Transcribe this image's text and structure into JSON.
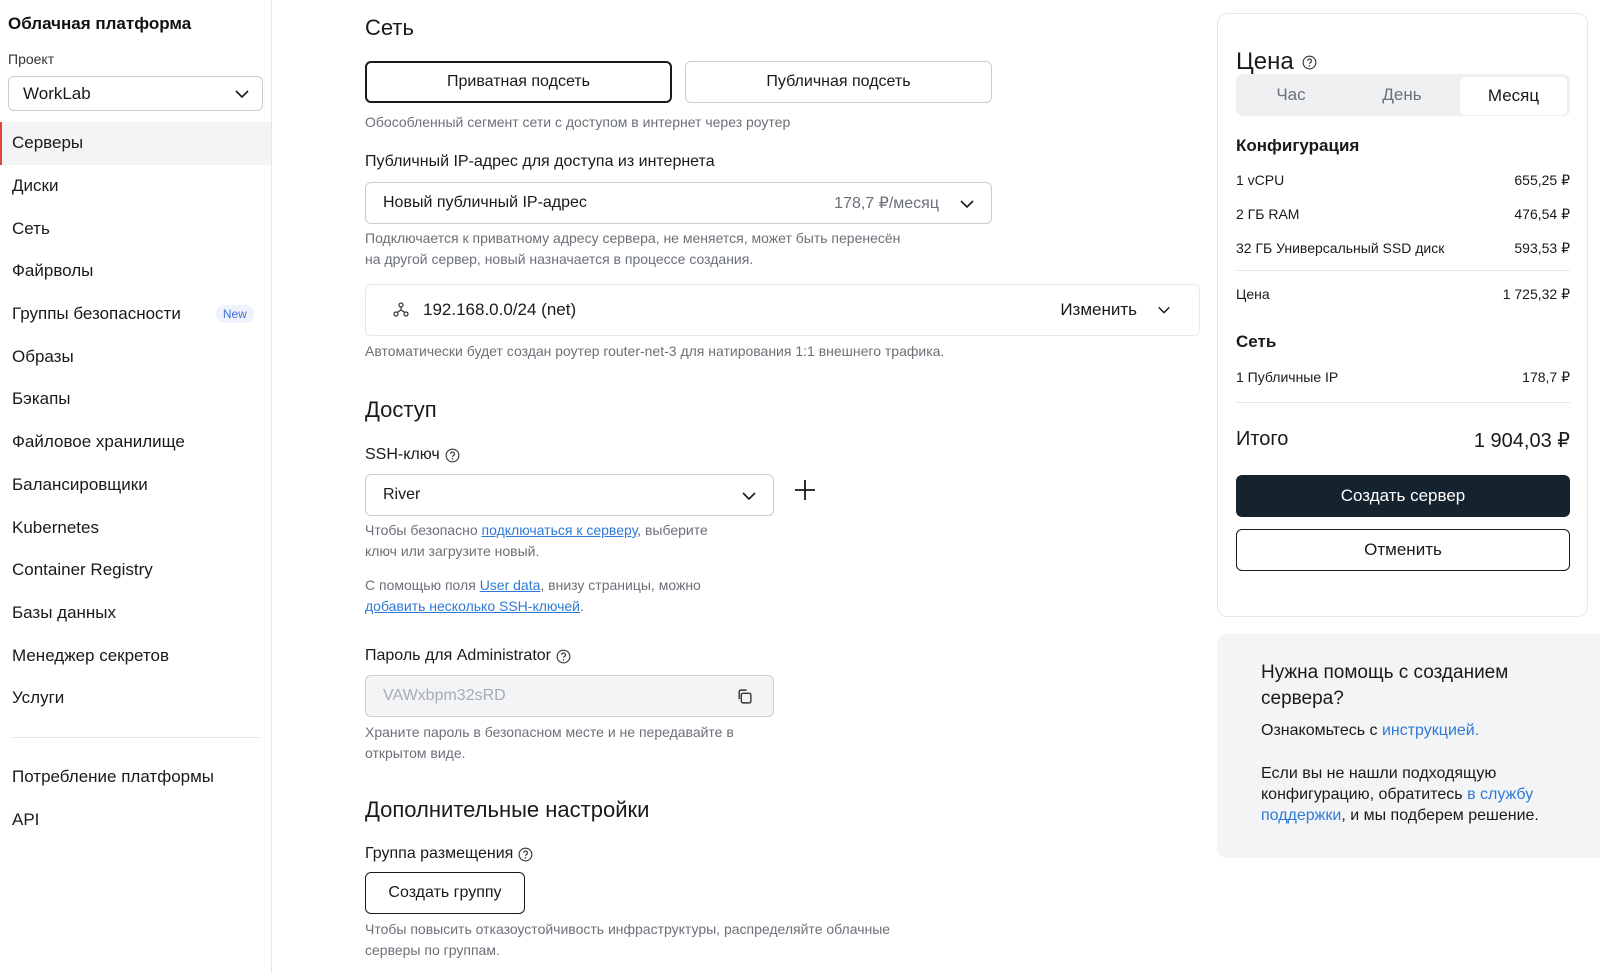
{
  "sidebar": {
    "title": "Облачная платформа",
    "project_label": "Проект",
    "project_value": "WorkLab",
    "items": [
      {
        "label": "Серверы"
      },
      {
        "label": "Диски"
      },
      {
        "label": "Сеть"
      },
      {
        "label": "Файрволы"
      },
      {
        "label": "Группы безопасности",
        "badge": "New"
      },
      {
        "label": "Образы"
      },
      {
        "label": "Бэкапы"
      },
      {
        "label": "Файловое хранилище"
      },
      {
        "label": "Балансировщики"
      },
      {
        "label": "Kubernetes"
      },
      {
        "label": "Container Registry"
      },
      {
        "label": "Базы данных"
      },
      {
        "label": "Менеджер секретов"
      },
      {
        "label": "Услуги"
      }
    ],
    "items2": [
      {
        "label": "Потребление платформы"
      },
      {
        "label": "API"
      }
    ]
  },
  "network": {
    "title": "Сеть",
    "private_subnet": "Приватная подсеть",
    "public_subnet": "Публичная подсеть",
    "subnet_hint": "Обособленный сегмент сети с доступом в интернет через роутер",
    "ip_label": "Публичный IP-адрес для доступа из интернета",
    "ip_value": "Новый публичный IP-адрес",
    "ip_price": "178,7 ₽/месяц",
    "ip_hint_1": "Подключается к приватному адресу сервера, не меняется, может быть перенесён",
    "ip_hint_2": "на другой сервер, новый назначается в процессе создания.",
    "net_value": "192.168.0.0/24 (net)",
    "net_change": "Изменить",
    "router_hint": "Автоматически будет создан роутер router-net-3 для натирования 1:1 внешнего трафика."
  },
  "access": {
    "title": "Доступ",
    "ssh_label": "SSH-ключ",
    "ssh_value": "River",
    "ssh_hint_a": "Чтобы безопасно ",
    "ssh_hint_link": "подключаться к серверу",
    "ssh_hint_b": ", выберите",
    "ssh_hint_c": "ключ или загрузите новый.",
    "ud_hint_a": "С помощью поля ",
    "ud_hint_link": "User data",
    "ud_hint_b": ", внизу страницы, можно",
    "ud_hint_link2": "добавить несколько SSH-ключей",
    "ud_hint_c": ".",
    "pwd_label": "Пароль для Administrator",
    "pwd_value": "VAWxbpm32sRD",
    "pwd_hint_1": "Храните пароль в безопасном месте и не передавайте в",
    "pwd_hint_2": "открытом виде."
  },
  "advanced": {
    "title": "Дополнительные настройки",
    "group_label": "Группа размещения",
    "create_group": "Создать группу",
    "group_hint_1": "Чтобы повысить отказоустойчивость инфраструктуры, распределяйте облачные",
    "group_hint_2": "серверы по группам."
  },
  "price": {
    "title": "Цена",
    "tabs": [
      "Час",
      "День",
      "Месяц"
    ],
    "active_tab": "Месяц",
    "config_title": "Конфигурация",
    "rows": [
      {
        "name": "1 vCPU",
        "value": "655,25 ₽"
      },
      {
        "name": "2 ГБ RAM",
        "value": "476,54 ₽"
      },
      {
        "name": "32 ГБ Универсальный SSD диск",
        "value": "593,53 ₽"
      }
    ],
    "subtotal_name": "Цена",
    "subtotal_value": "1 725,32 ₽",
    "net_title": "Сеть",
    "net_row_name": "1 Публичные IP",
    "net_row_value": "178,7 ₽",
    "total_name": "Итого",
    "total_value": "1 904,03 ₽",
    "create_button": "Создать сервер",
    "cancel_button": "Отменить"
  },
  "help": {
    "title": "Нужна помощь с созданием сервера?",
    "line1_a": "Ознакомьтесь с ",
    "line1_link": "инструкцией.",
    "line2_a": "Если вы не нашли подходящую конфигурацию, обратитесь ",
    "line2_link": "в службу поддержки",
    "line2_b": ", и мы подберем решение."
  },
  "colors": {
    "accent_link": "#2f7ad6",
    "primary_button": "#15232f",
    "active_indicator": "#e0473c"
  }
}
